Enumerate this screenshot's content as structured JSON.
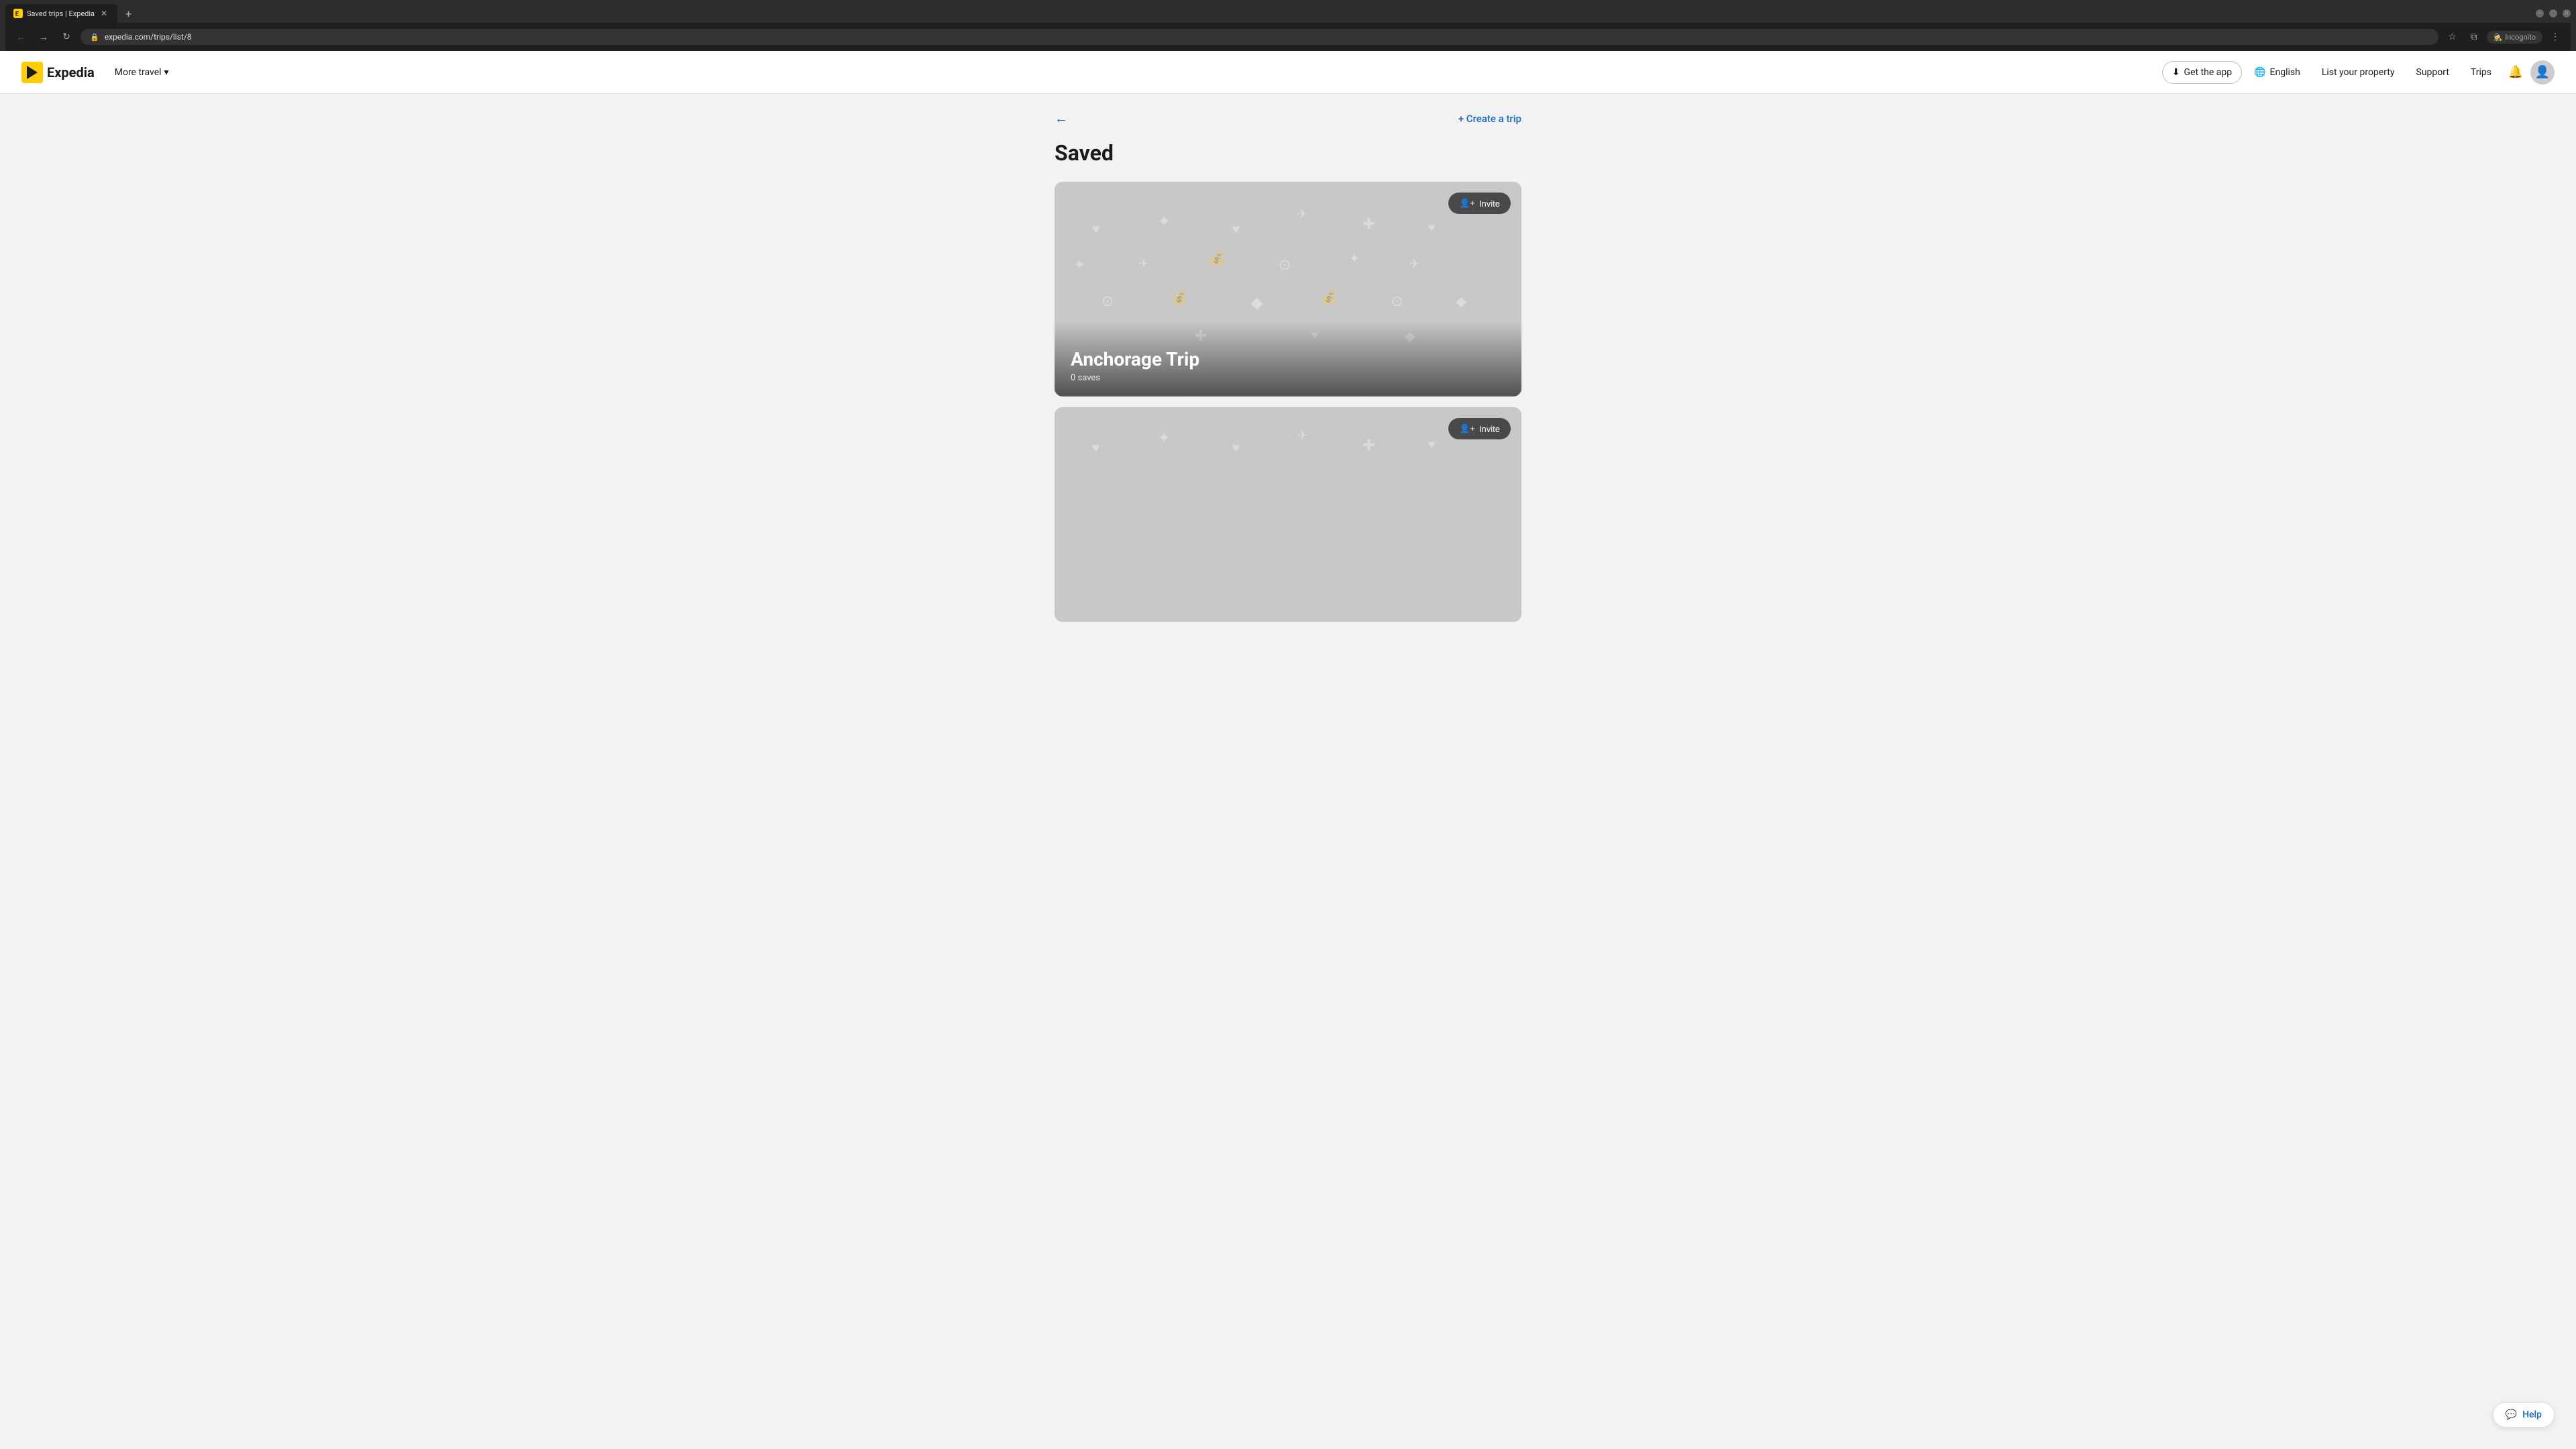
{
  "browser": {
    "tab_title": "Saved trips | Expedia",
    "tab_favicon": "✈",
    "url": "expedia.com/trips/list/8",
    "new_tab_label": "+",
    "incognito_label": "Incognito",
    "nav": {
      "back_disabled": false,
      "forward_disabled": true
    }
  },
  "header": {
    "logo_text": "Expedia",
    "more_travel_label": "More travel",
    "get_app_label": "Get the app",
    "english_label": "English",
    "list_property_label": "List your property",
    "support_label": "Support",
    "trips_label": "Trips"
  },
  "page": {
    "back_label": "←",
    "create_trip_label": "+ Create a trip",
    "title": "Saved",
    "trips": [
      {
        "name": "Anchorage Trip",
        "saves": "0 saves",
        "invite_label": "Invite"
      },
      {
        "name": "",
        "saves": "",
        "invite_label": "Invite"
      }
    ]
  },
  "help": {
    "label": "Help"
  },
  "icons": {
    "chevron_down": "▾",
    "globe": "🌐",
    "download": "⬇",
    "bell": "🔔",
    "user": "👤",
    "star": "☆",
    "sidebar": "⧉",
    "back_arrow": "←",
    "forward_arrow": "→",
    "refresh": "↻",
    "lock": "🔒",
    "menu": "⋮",
    "add_person": "👤+",
    "chat": "💬"
  }
}
